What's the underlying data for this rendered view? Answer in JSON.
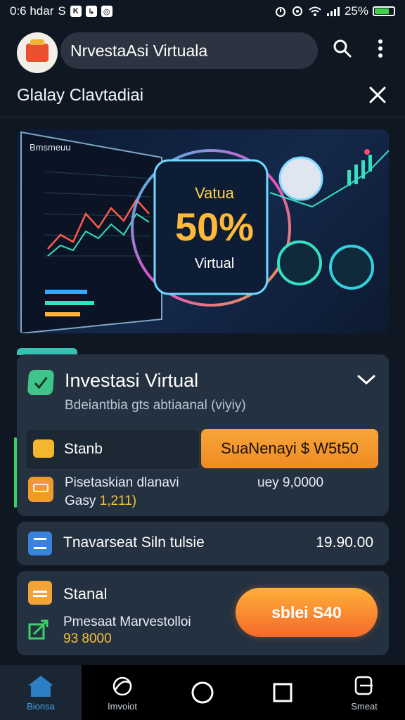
{
  "status_bar": {
    "time_text": "0:6 hdar",
    "letter": "S",
    "battery_text": "25%",
    "battery_level_pct": 80
  },
  "app_bar": {
    "title": "NrvestaAsi Virtuala"
  },
  "subheader": {
    "title": "Glalay Clavtadiai"
  },
  "banner": {
    "panel_title": "Bmsmeuu",
    "badge_top": "Vatua",
    "badge_percent": "50%",
    "badge_bottom": "Virtual"
  },
  "card_main": {
    "title": "Investasi Virtual",
    "subtitle": "Bdeiantbia gts abtiaanal (viyiy)",
    "row1": {
      "label": "Stanb",
      "button": "SuaNenayi $ W5t50"
    },
    "row2": {
      "line1": "Pisetaskian dlanavi",
      "line2_prefix": "Gasy",
      "line2_highlight": "1,211)",
      "value": "uey 9,0000"
    }
  },
  "card_2": {
    "title": "Tnavarseat Siln tulsie",
    "value": "19.90.00"
  },
  "card_3": {
    "title": "Stanal",
    "line1": "Pmesaat Marvestolloi",
    "line2": "93 8000",
    "button": "sblei S40"
  },
  "nav": {
    "items": [
      {
        "label": "Bionsa"
      },
      {
        "label": "Imvoiot"
      },
      {
        "label": ""
      },
      {
        "label": ""
      },
      {
        "label": "Smeat"
      }
    ]
  },
  "colors": {
    "background": "#0f1722",
    "card": "#243140",
    "accent_orange": "#ef8b22",
    "accent_teal": "#37c1b3",
    "accent_green": "#3fcf6a",
    "highlight_yellow": "#f3c33a"
  }
}
